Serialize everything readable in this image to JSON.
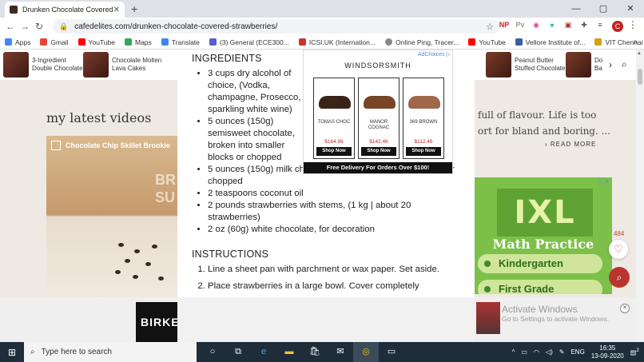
{
  "browser": {
    "tab_title": "Drunken Chocolate Covered Stra",
    "new_tab": "+",
    "url": "cafedelites.com/drunken-chocolate-covered-strawberries/",
    "window_controls": [
      "—",
      "▢",
      "✕"
    ],
    "bookmarks": [
      "Apps",
      "Gmail",
      "YouTube",
      "Maps",
      "Translate",
      "(3) General (ECE300...",
      "ICSI.UK (Internation...",
      "Online Ping, Tracer...",
      "YouTube",
      "Vellore Institute of...",
      "VIT Chennai"
    ],
    "extensions": [
      "NP",
      "Pv"
    ],
    "profile_initial": "C",
    "bookmarks_more": "»"
  },
  "strip": [
    {
      "label": "3-Ingredient\nDouble Chocolate"
    },
    {
      "label": "Chocolate Molten\nLava Cakes"
    },
    {
      "label": "Peanut Butter\nStuffed Chocolate"
    },
    {
      "label": "Do\nBa"
    }
  ],
  "left": {
    "section_title": "my latest videos",
    "video_caption": "Chocolate Chip Skillet Brookie",
    "video_overlay": "BR\nSU"
  },
  "right": {
    "text_line1": "full of flavour. Life is too",
    "text_line2": "ort for bland and boring. ...",
    "read_more": "› READ MORE",
    "ixl_logo": "IXL",
    "ixl_sub": "Math Practice",
    "ixl_items": [
      "Kindergarten",
      "First Grade",
      "Second Grade"
    ],
    "share_count": "484"
  },
  "recipe": {
    "ingredients_heading": "INGREDIENTS",
    "ingredients": [
      "3 cups dry alcohol of choice, (Vodka, champagne, Prosecco, sparkling white wine)",
      "5 ounces (150g) semisweet chocolate, broken into smaller blocks or chopped",
      "5 ounces (150g) milk chocolate, broken into smaller blocks or chopped",
      "2 teaspoons coconut oil",
      "2 pounds strawberries with stems, (1 kg | about 20 strawberries)",
      "2 oz (60g) white chocolate, for decoration"
    ],
    "instructions_heading": "INSTRUCTIONS",
    "instructions": [
      "Line a sheet pan with parchment or wax paper. Set aside.",
      "Place strawberries in a large bowl. Cover completely"
    ]
  },
  "ad": {
    "adchoices": "AdChoices ▷",
    "brand": "WINDSORSMITH",
    "products": [
      {
        "name": "TOMAS CHOC",
        "price": "$164.96",
        "button": "Shop Now",
        "color": "#3a2418"
      },
      {
        "name": "MANOR COGNAC",
        "price": "$142.46",
        "button": "Shop Now",
        "color": "#7a4426"
      },
      {
        "name": "369 BROWN",
        "price": "$112.46",
        "button": "Shop Now",
        "color": "#a0674a"
      }
    ],
    "banner": "Free Delivery For Orders Over $100!"
  },
  "bottom": {
    "ad_brand": "BIRKE",
    "watermark_title": "Activate Windows",
    "watermark_sub": "Go to Settings to activate Windows."
  },
  "taskbar": {
    "search_placeholder": "Type here to search",
    "lang": "ENG",
    "time": "16:35",
    "date": "13-09-2020",
    "notifications": "2"
  },
  "colors": {
    "accent": "#b8362f",
    "ixl_green": "#7cc04a",
    "page_bg": "#f4f1ee"
  }
}
